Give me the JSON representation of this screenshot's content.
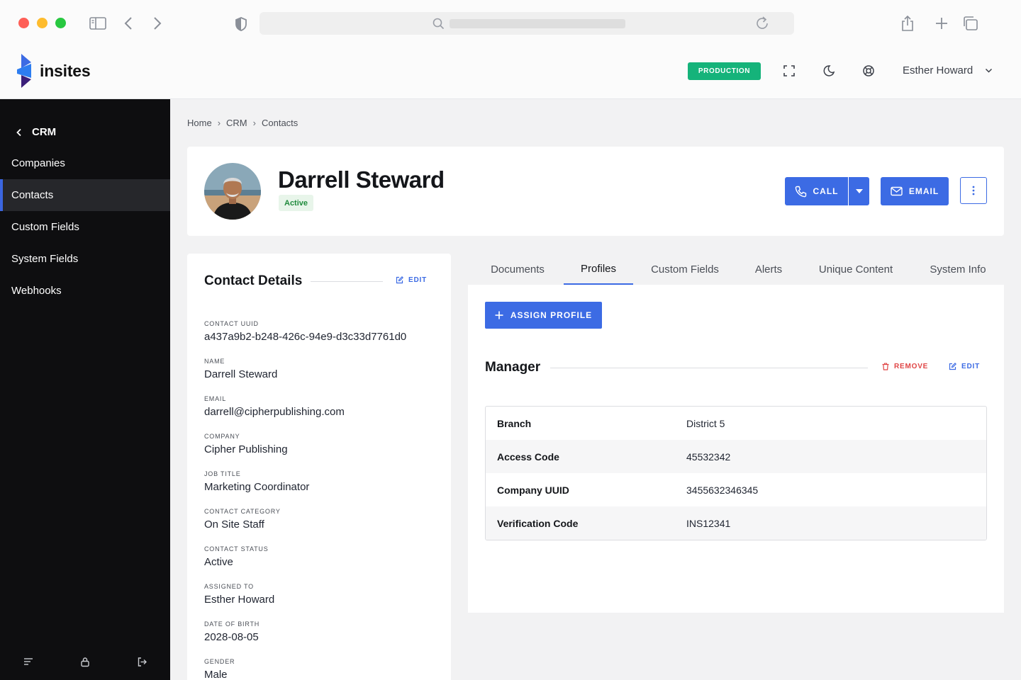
{
  "app": {
    "name": "insites"
  },
  "header": {
    "environment_badge": "PRODUCTION",
    "user_name": "Esther Howard",
    "icons": [
      "fullscreen-icon",
      "moon-icon",
      "help-lifebuoy-icon",
      "chevron-down-icon"
    ]
  },
  "sidebar": {
    "back_label": "CRM",
    "items": [
      {
        "label": "Companies",
        "active": false
      },
      {
        "label": "Contacts",
        "active": true
      },
      {
        "label": "Custom Fields",
        "active": false
      },
      {
        "label": "System Fields",
        "active": false
      },
      {
        "label": "Webhooks",
        "active": false
      }
    ],
    "footer_icons": [
      "menu-icon",
      "lock-icon",
      "logout-icon"
    ]
  },
  "breadcrumb": [
    "Home",
    "CRM",
    "Contacts"
  ],
  "contact": {
    "name": "Darrell Steward",
    "status": "Active",
    "actions": {
      "call": "CALL",
      "email": "EMAIL"
    }
  },
  "details": {
    "title": "Contact Details",
    "edit_label": "EDIT",
    "fields": [
      {
        "label": "Contact UUID",
        "value": "a437a9b2-b248-426c-94e9-d3c33d7761d0"
      },
      {
        "label": "Name",
        "value": "Darrell Steward"
      },
      {
        "label": "Email",
        "value": "darrell@cipherpublishing.com"
      },
      {
        "label": "Company",
        "value": "Cipher Publishing"
      },
      {
        "label": "Job Title",
        "value": "Marketing Coordinator"
      },
      {
        "label": "Contact Category",
        "value": "On Site Staff"
      },
      {
        "label": "Contact Status",
        "value": "Active"
      },
      {
        "label": "Assigned To",
        "value": "Esther Howard"
      },
      {
        "label": "Date of Birth",
        "value": "2028-08-05"
      },
      {
        "label": "Gender",
        "value": "Male"
      }
    ]
  },
  "tabs": [
    {
      "label": "Documents",
      "active": false
    },
    {
      "label": "Profiles",
      "active": true
    },
    {
      "label": "Custom Fields",
      "active": false
    },
    {
      "label": "Alerts",
      "active": false
    },
    {
      "label": "Unique Content",
      "active": false
    },
    {
      "label": "System Info",
      "active": false
    }
  ],
  "profiles": {
    "assign_label": "ASSIGN PROFILE",
    "section_title": "Manager",
    "remove_label": "REMOVE",
    "edit_label": "EDIT",
    "rows": [
      {
        "key": "Branch",
        "value": "District 5"
      },
      {
        "key": "Access Code",
        "value": "45532342"
      },
      {
        "key": "Company UUID",
        "value": "3455632346345"
      },
      {
        "key": "Verification Code",
        "value": "INS12341"
      }
    ]
  },
  "colors": {
    "accent": "#3c6be4",
    "success": "#15b37a",
    "danger": "#e04545",
    "sidebar_bg": "#0e0e10"
  }
}
